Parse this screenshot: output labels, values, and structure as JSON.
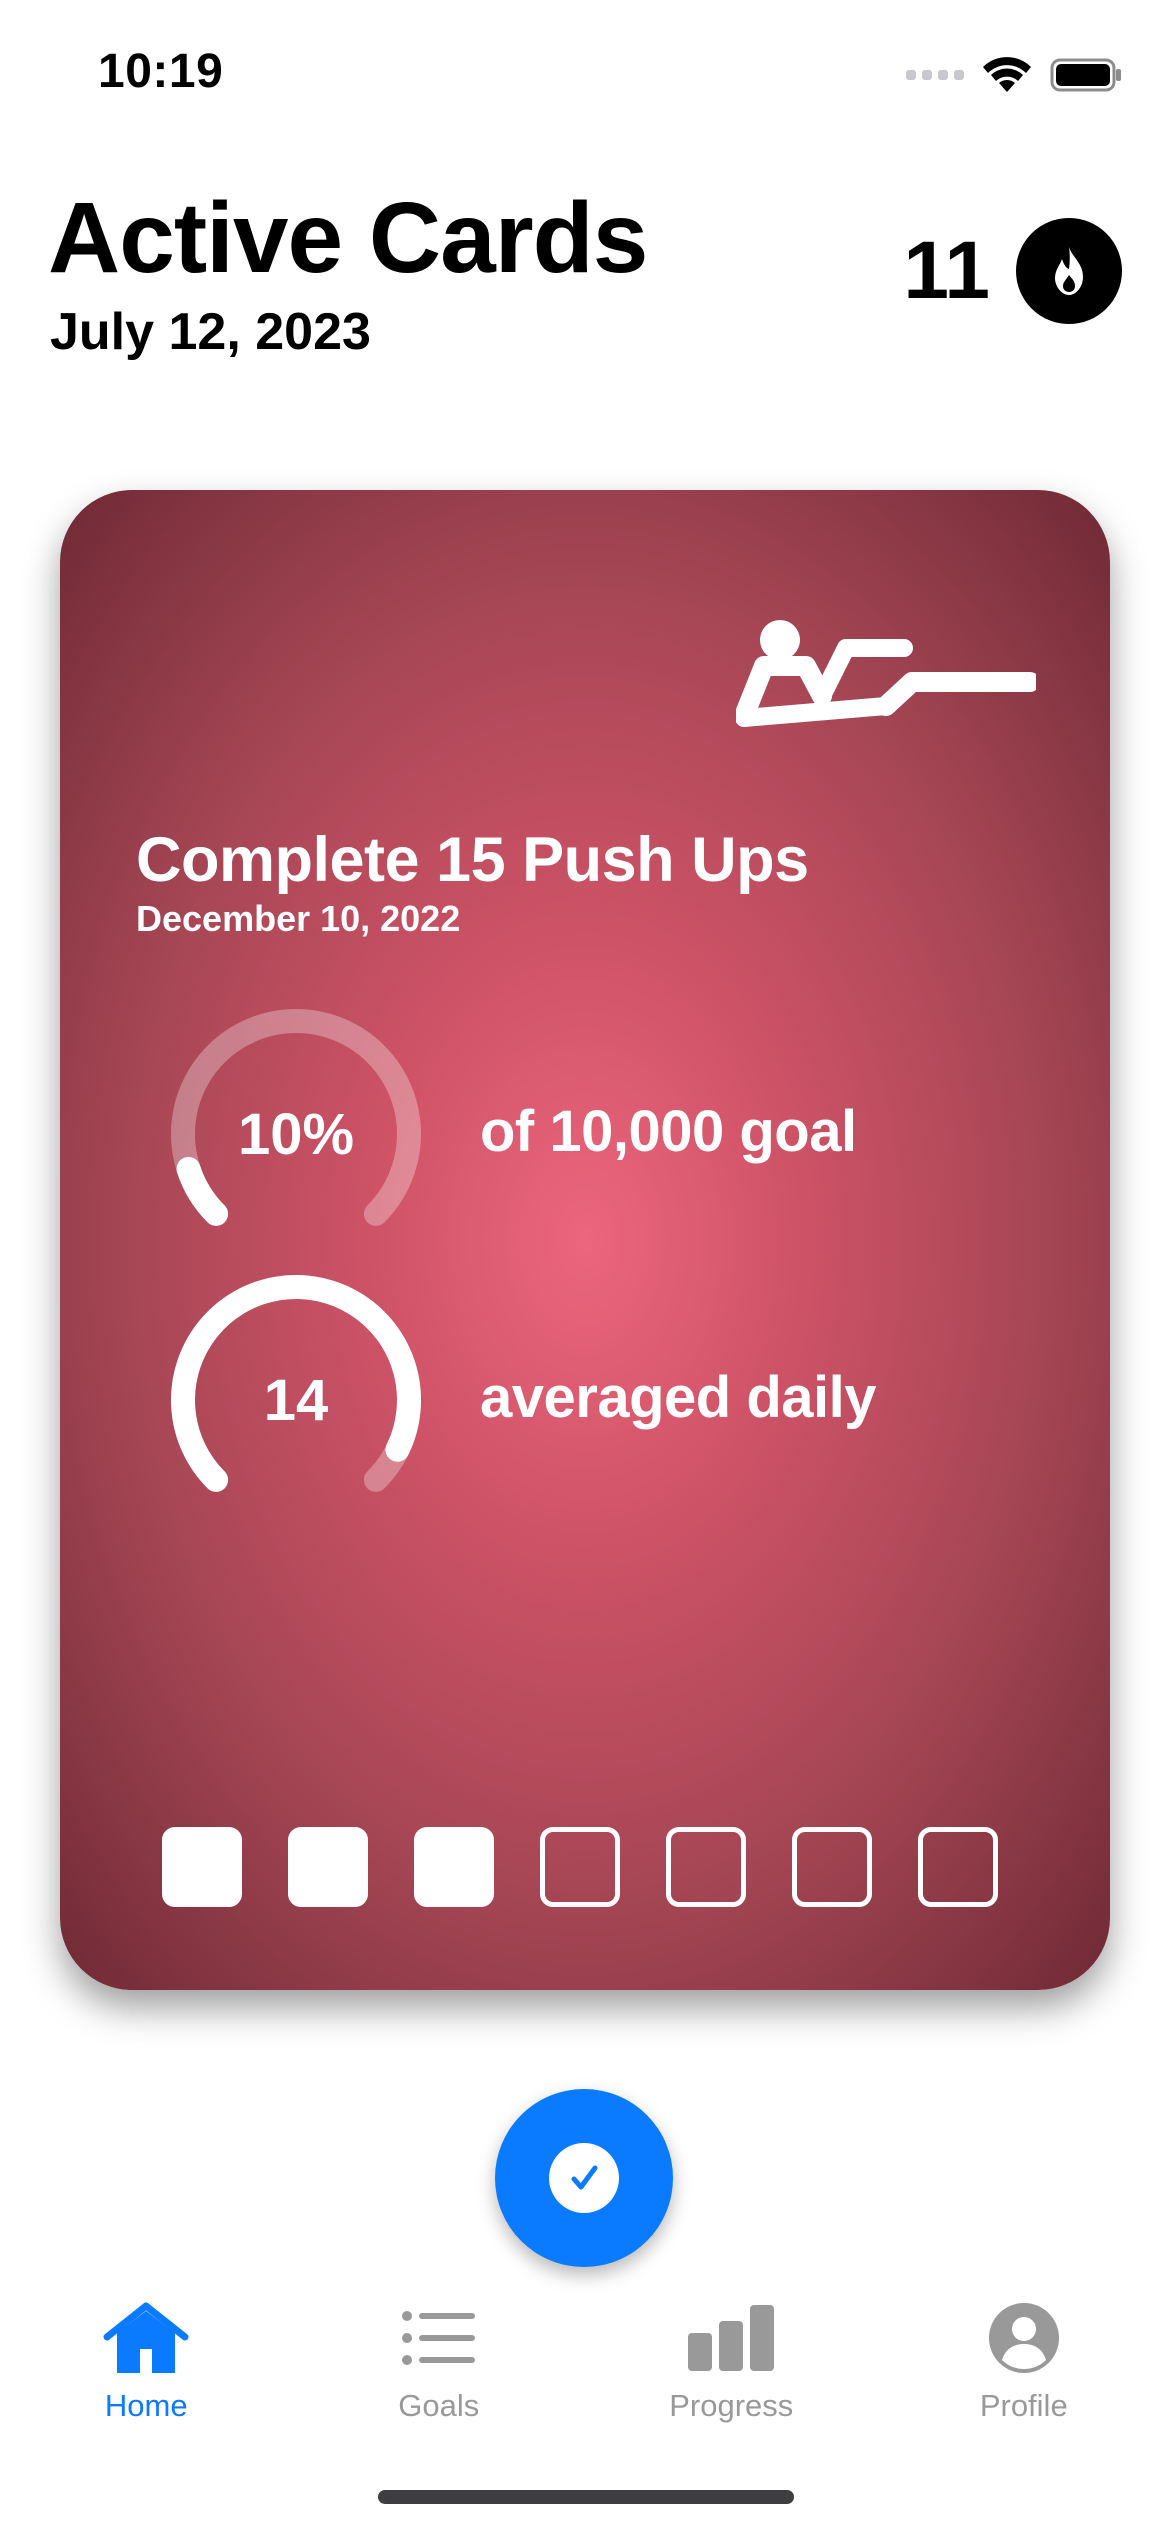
{
  "status_bar": {
    "time": "10:19"
  },
  "header": {
    "title": "Active Cards",
    "date": "July 12, 2023",
    "streak_count": "11",
    "streak_icon": "flame-icon"
  },
  "card": {
    "title": "Complete 15 Push Ups",
    "date": "December 10, 2022",
    "activity_icon": "push-up-icon",
    "gradient_colors": [
      "#ec667c",
      "#cf5367",
      "#a64655",
      "#6f2a35"
    ],
    "metrics": [
      {
        "ring_value": "10%",
        "fraction": 0.1,
        "label": "of 10,000 goal"
      },
      {
        "ring_value": "14",
        "fraction": 0.93,
        "label": "averaged daily"
      }
    ],
    "days_completed": [
      true,
      true,
      true,
      false,
      false,
      false,
      false
    ]
  },
  "fab": {
    "icon": "checkmark-icon",
    "color": "#0a7aff"
  },
  "tab_bar": {
    "accent_color": "#0a7aff",
    "inactive_color": "#999999",
    "tabs": [
      {
        "label": "Home",
        "icon": "house-icon",
        "active": true
      },
      {
        "label": "Goals",
        "icon": "list-icon",
        "active": false
      },
      {
        "label": "Progress",
        "icon": "bar-chart-icon",
        "active": false
      },
      {
        "label": "Profile",
        "icon": "person-icon",
        "active": false
      }
    ]
  }
}
